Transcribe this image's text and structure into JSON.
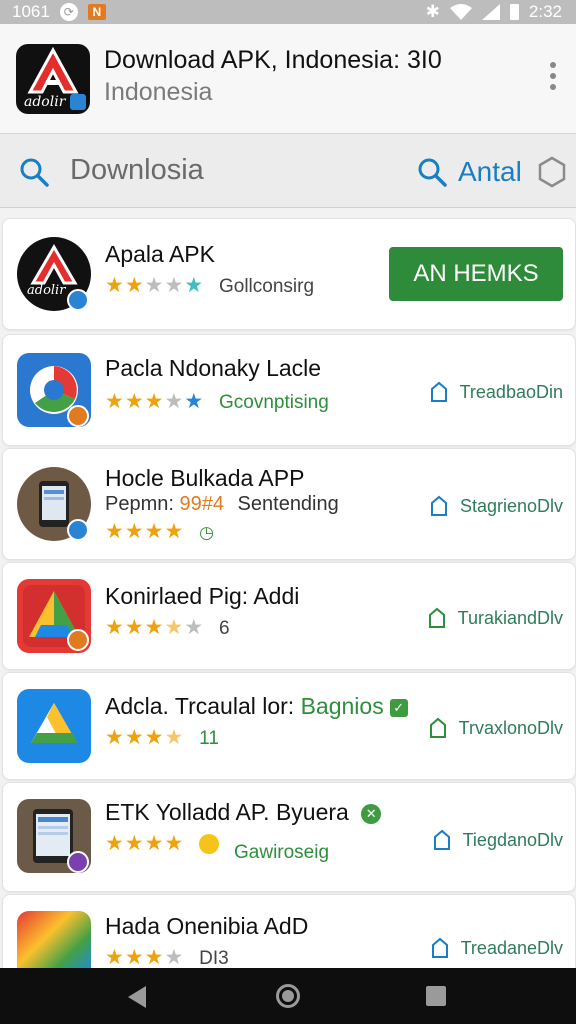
{
  "status_bar": {
    "time_left": "1061",
    "time_right": "2:32"
  },
  "header": {
    "title": "Download APK, Indonesia: 3I0",
    "subtitle": "Indonesia",
    "logo_text": "adolir"
  },
  "search": {
    "query": "Downlosia",
    "secondary_label": "Antal"
  },
  "apps": [
    {
      "name": "Apala APK",
      "rating_label": "Gollconsirg",
      "action_label": "AN HEMKS",
      "icon_text": "adolir"
    },
    {
      "name": "Pacla Ndonaky Lacle",
      "rating_label": "Gcovnptising",
      "action_label": "TreadbaoDin"
    },
    {
      "name": "Hocle Bulkada APP",
      "subline_prefix": "Pepmn: ",
      "subline_highlight": "99#4",
      "subline_suffix": "Sentending",
      "action_label": "StagrienoDlv"
    },
    {
      "name": "Konirlaed Pig: Addi",
      "rating_label": "6",
      "action_label": "TurakiandDlv"
    },
    {
      "name": "Adcla. Trcaulal lor: ",
      "name_highlight": "Bagnios",
      "rating_label": "11",
      "action_label": "TrvaxlonoDlv"
    },
    {
      "name": "ETK Yolladd AP. Byuera",
      "rating_label": "Gawiroseig",
      "action_label": "TiegdanoDlv"
    },
    {
      "name": "Hada Onenibia AdD",
      "rating_label": "DI3",
      "action_label": "TreadaneDlv"
    }
  ],
  "colors": {
    "accent_green": "#2e8b3a",
    "star": "#f0a20c",
    "link_blue": "#1a7fc2"
  }
}
